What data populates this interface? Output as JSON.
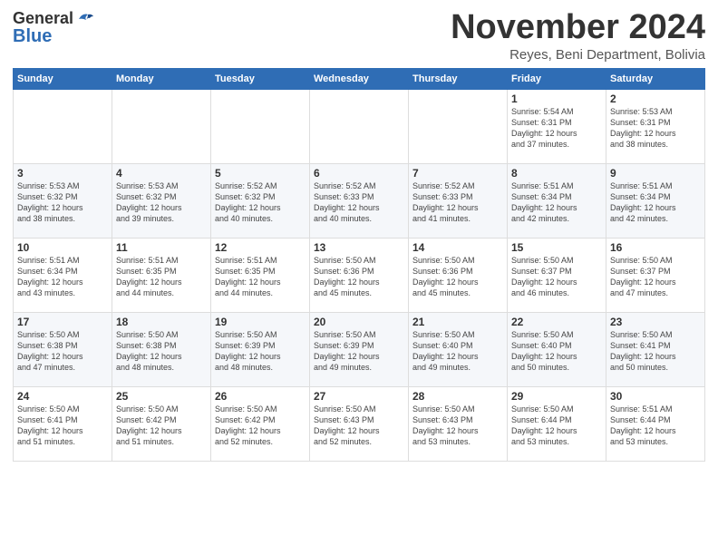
{
  "logo": {
    "general": "General",
    "blue": "Blue"
  },
  "header": {
    "month": "November 2024",
    "location": "Reyes, Beni Department, Bolivia"
  },
  "weekdays": [
    "Sunday",
    "Monday",
    "Tuesday",
    "Wednesday",
    "Thursday",
    "Friday",
    "Saturday"
  ],
  "weeks": [
    [
      {
        "day": "",
        "info": ""
      },
      {
        "day": "",
        "info": ""
      },
      {
        "day": "",
        "info": ""
      },
      {
        "day": "",
        "info": ""
      },
      {
        "day": "",
        "info": ""
      },
      {
        "day": "1",
        "info": "Sunrise: 5:54 AM\nSunset: 6:31 PM\nDaylight: 12 hours\nand 37 minutes."
      },
      {
        "day": "2",
        "info": "Sunrise: 5:53 AM\nSunset: 6:31 PM\nDaylight: 12 hours\nand 38 minutes."
      }
    ],
    [
      {
        "day": "3",
        "info": "Sunrise: 5:53 AM\nSunset: 6:32 PM\nDaylight: 12 hours\nand 38 minutes."
      },
      {
        "day": "4",
        "info": "Sunrise: 5:53 AM\nSunset: 6:32 PM\nDaylight: 12 hours\nand 39 minutes."
      },
      {
        "day": "5",
        "info": "Sunrise: 5:52 AM\nSunset: 6:32 PM\nDaylight: 12 hours\nand 40 minutes."
      },
      {
        "day": "6",
        "info": "Sunrise: 5:52 AM\nSunset: 6:33 PM\nDaylight: 12 hours\nand 40 minutes."
      },
      {
        "day": "7",
        "info": "Sunrise: 5:52 AM\nSunset: 6:33 PM\nDaylight: 12 hours\nand 41 minutes."
      },
      {
        "day": "8",
        "info": "Sunrise: 5:51 AM\nSunset: 6:34 PM\nDaylight: 12 hours\nand 42 minutes."
      },
      {
        "day": "9",
        "info": "Sunrise: 5:51 AM\nSunset: 6:34 PM\nDaylight: 12 hours\nand 42 minutes."
      }
    ],
    [
      {
        "day": "10",
        "info": "Sunrise: 5:51 AM\nSunset: 6:34 PM\nDaylight: 12 hours\nand 43 minutes."
      },
      {
        "day": "11",
        "info": "Sunrise: 5:51 AM\nSunset: 6:35 PM\nDaylight: 12 hours\nand 44 minutes."
      },
      {
        "day": "12",
        "info": "Sunrise: 5:51 AM\nSunset: 6:35 PM\nDaylight: 12 hours\nand 44 minutes."
      },
      {
        "day": "13",
        "info": "Sunrise: 5:50 AM\nSunset: 6:36 PM\nDaylight: 12 hours\nand 45 minutes."
      },
      {
        "day": "14",
        "info": "Sunrise: 5:50 AM\nSunset: 6:36 PM\nDaylight: 12 hours\nand 45 minutes."
      },
      {
        "day": "15",
        "info": "Sunrise: 5:50 AM\nSunset: 6:37 PM\nDaylight: 12 hours\nand 46 minutes."
      },
      {
        "day": "16",
        "info": "Sunrise: 5:50 AM\nSunset: 6:37 PM\nDaylight: 12 hours\nand 47 minutes."
      }
    ],
    [
      {
        "day": "17",
        "info": "Sunrise: 5:50 AM\nSunset: 6:38 PM\nDaylight: 12 hours\nand 47 minutes."
      },
      {
        "day": "18",
        "info": "Sunrise: 5:50 AM\nSunset: 6:38 PM\nDaylight: 12 hours\nand 48 minutes."
      },
      {
        "day": "19",
        "info": "Sunrise: 5:50 AM\nSunset: 6:39 PM\nDaylight: 12 hours\nand 48 minutes."
      },
      {
        "day": "20",
        "info": "Sunrise: 5:50 AM\nSunset: 6:39 PM\nDaylight: 12 hours\nand 49 minutes."
      },
      {
        "day": "21",
        "info": "Sunrise: 5:50 AM\nSunset: 6:40 PM\nDaylight: 12 hours\nand 49 minutes."
      },
      {
        "day": "22",
        "info": "Sunrise: 5:50 AM\nSunset: 6:40 PM\nDaylight: 12 hours\nand 50 minutes."
      },
      {
        "day": "23",
        "info": "Sunrise: 5:50 AM\nSunset: 6:41 PM\nDaylight: 12 hours\nand 50 minutes."
      }
    ],
    [
      {
        "day": "24",
        "info": "Sunrise: 5:50 AM\nSunset: 6:41 PM\nDaylight: 12 hours\nand 51 minutes."
      },
      {
        "day": "25",
        "info": "Sunrise: 5:50 AM\nSunset: 6:42 PM\nDaylight: 12 hours\nand 51 minutes."
      },
      {
        "day": "26",
        "info": "Sunrise: 5:50 AM\nSunset: 6:42 PM\nDaylight: 12 hours\nand 52 minutes."
      },
      {
        "day": "27",
        "info": "Sunrise: 5:50 AM\nSunset: 6:43 PM\nDaylight: 12 hours\nand 52 minutes."
      },
      {
        "day": "28",
        "info": "Sunrise: 5:50 AM\nSunset: 6:43 PM\nDaylight: 12 hours\nand 53 minutes."
      },
      {
        "day": "29",
        "info": "Sunrise: 5:50 AM\nSunset: 6:44 PM\nDaylight: 12 hours\nand 53 minutes."
      },
      {
        "day": "30",
        "info": "Sunrise: 5:51 AM\nSunset: 6:44 PM\nDaylight: 12 hours\nand 53 minutes."
      }
    ]
  ]
}
